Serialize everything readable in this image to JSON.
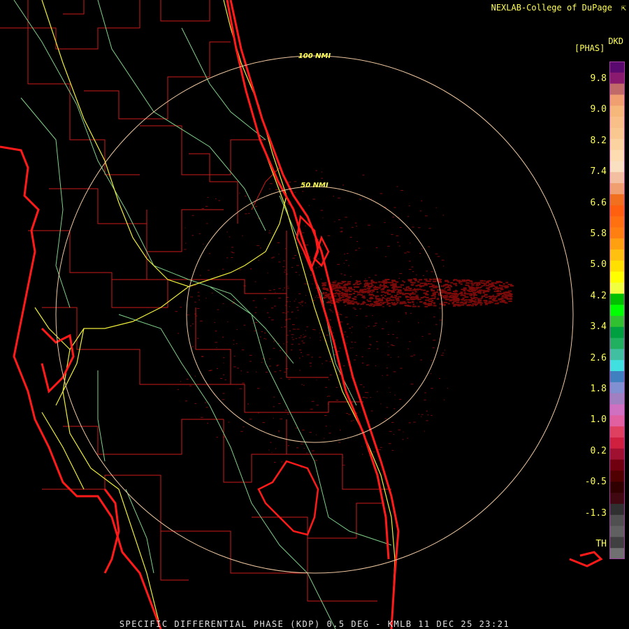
{
  "header": {
    "credit": "NEXLAB-College of DuPage",
    "credit_icon": "cursor-arrow-icon",
    "product_code": "DKD",
    "units": "[PHAS]"
  },
  "footer": {
    "title": "SPECIFIC DIFFERENTIAL PHASE (KDP) 0.5 DEG - KMLB 11 DEC 25 23:21"
  },
  "range_rings": [
    {
      "label": "100 NMI"
    },
    {
      "label": "50 NMI"
    }
  ],
  "legend": {
    "ticks": [
      "9.8",
      "9.0",
      "8.2",
      "7.4",
      "6.6",
      "5.8",
      "5.0",
      "4.2",
      "3.4",
      "2.6",
      "1.8",
      "1.0",
      "0.2",
      "-0.5",
      "-1.3",
      "TH"
    ],
    "colors": [
      "#5a0a6e",
      "#8a1a6e",
      "#c06a6a",
      "#f0a070",
      "#f6b87a",
      "#f8c088",
      "#f8c890",
      "#fbd3a0",
      "#fcdcb0",
      "#f8e0c0",
      "#f2c0a0",
      "#f0a070",
      "#f07020",
      "#ff6010",
      "#ff7010",
      "#ff8010",
      "#ffa010",
      "#ffc010",
      "#ffe000",
      "#ffff00",
      "#f0ff40",
      "#00c000",
      "#00ff00",
      "#30c030",
      "#00a040",
      "#20b060",
      "#40c0a0",
      "#40e0e0",
      "#4080c0",
      "#8090d0",
      "#a080c0",
      "#d070c0",
      "#e060a0",
      "#e04060",
      "#d02040",
      "#a01030",
      "#700010",
      "#500000",
      "#300000",
      "#400810",
      "#303030",
      "#505050",
      "#606060",
      "#404040",
      "#707070"
    ],
    "accent": "#ffff55"
  },
  "map_colors": {
    "background": "#000000",
    "county": "#cc1a1a",
    "coast": "#ff1a1a",
    "interstate": "#eded3a",
    "highway": "#7fd08a",
    "ring": "#f0c8a0",
    "echo": "#7a0a0a"
  }
}
